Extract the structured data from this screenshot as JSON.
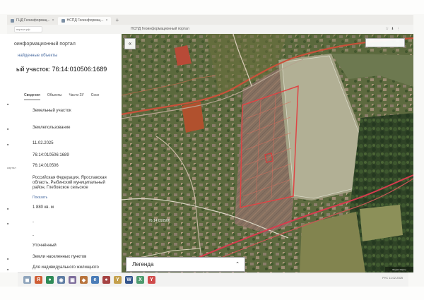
{
  "browser": {
    "tabs": [
      {
        "label": "ГЦД Геоинформац...",
        "active": false
      },
      {
        "label": "НСПД Геоинформац...",
        "active": true
      }
    ],
    "new_tab": "+",
    "url_short": "портал.рф",
    "page_title": "НСПД Геоинформационный портал",
    "toolbar": "☆  ⬇  ⋮"
  },
  "left_panel": {
    "portal_title": "оинформационный портал",
    "search_link": "найденные объекты",
    "cadastral_title": "ый участок: 76:14:010506:1689",
    "tabs": [
      "Сведения",
      "Объекты",
      "Части ЗУ",
      "Сосе"
    ],
    "rows": [
      {
        "marker": "",
        "value": "Земельный участок"
      },
      {
        "marker": "",
        "value": "Землепользование"
      },
      {
        "marker": "",
        "value": "11.02.2025"
      },
      {
        "marker": "",
        "value": "76:14:010506:1689"
      },
      {
        "marker": "картал",
        "value": "76:14:010506"
      },
      {
        "marker": "",
        "value": "Российская Федерация, Ярославская область, Рыбинский муниципальный район, Глебовское сельское"
      },
      {
        "marker": "",
        "value": "Показать"
      },
      {
        "marker": "",
        "value": "1 880 кв. м"
      },
      {
        "marker": "",
        "value": "-"
      },
      {
        "marker": "",
        "value": "-"
      },
      {
        "marker": "",
        "value": "Уточнённый"
      },
      {
        "marker": "",
        "value": "Земли населенных пунктов"
      },
      {
        "marker": "",
        "value": "Для индивидуального жилищного"
      }
    ]
  },
  "map": {
    "collapse_label": "«",
    "legend_label": "Легенда",
    "legend_toggle": "⌃",
    "parcel_label": "76:14:010506",
    "footer": "Яндекс.Карты"
  },
  "taskbar": {
    "tray": "РУС\n11.02.2025"
  }
}
